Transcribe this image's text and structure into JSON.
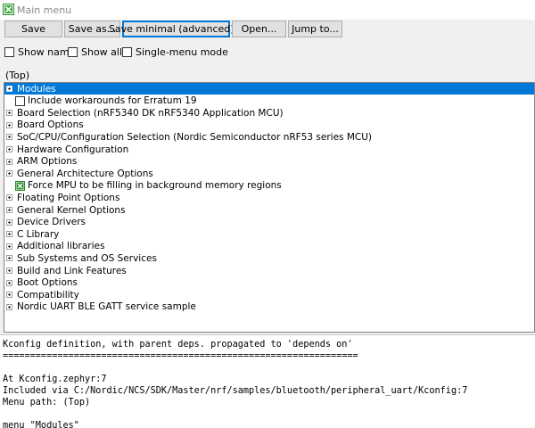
{
  "window": {
    "title": "Main menu",
    "icon": "checkbox-x-icon"
  },
  "toolbar": {
    "save": "Save",
    "save_as": "Save as...",
    "save_minimal": "Save minimal (advanced)...",
    "open": "Open...",
    "jump_to": "Jump to..."
  },
  "options": {
    "show_name": "Show name",
    "show_all": "Show all",
    "single_menu": "Single-menu mode"
  },
  "breadcrumb": "(Top)",
  "tree": {
    "items": [
      {
        "label": "Modules",
        "kind": "menu",
        "selected": true
      },
      {
        "label": "Include workarounds for Erratum 19",
        "kind": "checkbox",
        "checked": false
      },
      {
        "label": "Board Selection (nRF5340 DK nRF5340 Application MCU)",
        "kind": "menu"
      },
      {
        "label": "Board Options",
        "kind": "menu"
      },
      {
        "label": "SoC/CPU/Configuration Selection (Nordic Semiconductor nRF53 series MCU)",
        "kind": "menu"
      },
      {
        "label": "Hardware Configuration",
        "kind": "menu"
      },
      {
        "label": "ARM Options",
        "kind": "menu"
      },
      {
        "label": "General Architecture Options",
        "kind": "menu"
      },
      {
        "label": "Force MPU to be filling in background memory regions",
        "kind": "checkbox",
        "checked": true
      },
      {
        "label": "Floating Point Options",
        "kind": "menu"
      },
      {
        "label": "General Kernel Options",
        "kind": "menu"
      },
      {
        "label": "Device Drivers",
        "kind": "menu"
      },
      {
        "label": "C Library",
        "kind": "menu"
      },
      {
        "label": "Additional libraries",
        "kind": "menu"
      },
      {
        "label": "Sub Systems and OS Services",
        "kind": "menu"
      },
      {
        "label": "Build and Link Features",
        "kind": "menu"
      },
      {
        "label": "Boot Options",
        "kind": "menu"
      },
      {
        "label": "Compatibility",
        "kind": "menu"
      },
      {
        "label": "Nordic UART BLE GATT service sample",
        "kind": "menu"
      }
    ]
  },
  "console": {
    "lines": [
      "Kconfig definition, with parent deps. propagated to 'depends on'",
      "=================================================================",
      "",
      "At Kconfig.zephyr:7",
      "Included via C:/Nordic/NCS/SDK/Master/nrf/samples/bluetooth/peripheral_uart/Kconfig:7",
      "Menu path: (Top)",
      "",
      "menu \"Modules\""
    ]
  },
  "colors": {
    "selection": "#0078d7",
    "check_green": "#2a8a2a"
  }
}
